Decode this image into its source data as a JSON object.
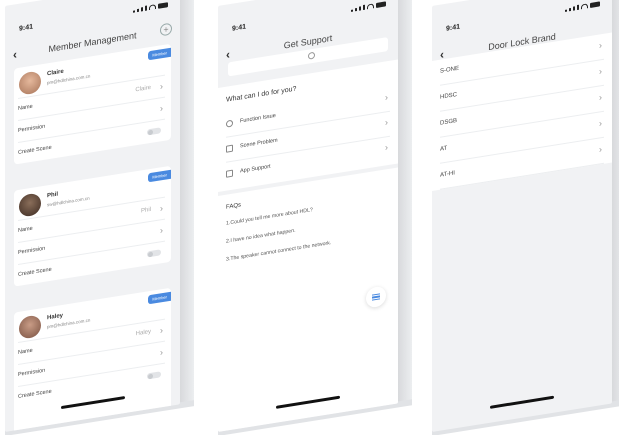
{
  "status": {
    "time": "9:41"
  },
  "member_management": {
    "title": "Member Management",
    "members": [
      {
        "name": "Claire",
        "email": "pm@hdlchina.com.cn",
        "badge": "Member",
        "rows": {
          "name_label": "Name",
          "name_value": "Claire",
          "permission_label": "Permission",
          "scene_label": "Create Scene"
        }
      },
      {
        "name": "Phil",
        "email": "sw@hdlchina.com.cn",
        "badge": "Member",
        "rows": {
          "name_label": "Name",
          "name_value": "Phil",
          "permission_label": "Permission",
          "scene_label": "Create Scene"
        }
      },
      {
        "name": "Haley",
        "email": "pm@hdlchina.com.cn",
        "badge": "Member",
        "rows": {
          "name_label": "Name",
          "name_value": "Haley",
          "permission_label": "Permission",
          "scene_label": "Create Scene"
        }
      }
    ]
  },
  "support": {
    "title": "Get Support",
    "question": "What can I do for you?",
    "items": [
      {
        "label": "Function Issue",
        "icon": "help-circle-icon"
      },
      {
        "label": "Scene Problem",
        "icon": "scene-icon"
      },
      {
        "label": "App Support",
        "icon": "app-icon"
      }
    ],
    "faqs_title": "FAQs",
    "faqs": [
      "1.Could you tell me more about HDL?",
      "2.I have no idea what happen.",
      "3.The speaker cannot connect to the network."
    ]
  },
  "brand": {
    "title": "Door Lock Brand",
    "items": [
      "S-ONE",
      "HDSC",
      "DSGB",
      "AT",
      "AT-HI"
    ]
  },
  "colors": {
    "accent": "#4a8ae0",
    "background": "#f1f2f4"
  }
}
